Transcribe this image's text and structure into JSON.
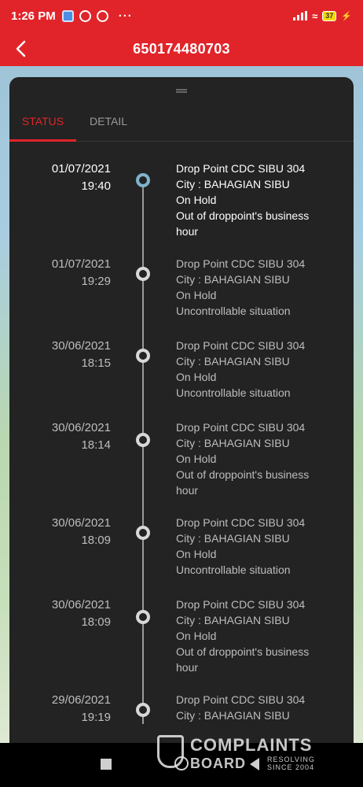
{
  "status_bar": {
    "time": "1:26 PM",
    "dots": "···",
    "battery": "37"
  },
  "app_bar": {
    "title": "650174480703",
    "back_icon": "chevron-left-icon"
  },
  "tabs": [
    {
      "label": "STATUS",
      "active": true
    },
    {
      "label": "DETAIL",
      "active": false
    }
  ],
  "events": [
    {
      "date": "01/07/2021",
      "time": "19:40",
      "location": "Drop Point CDC SIBU 304",
      "city": "City : BAHAGIAN SIBU",
      "status": "On Hold",
      "reason": "Out of droppoint's business hour"
    },
    {
      "date": "01/07/2021",
      "time": "19:29",
      "location": "Drop Point CDC SIBU 304",
      "city": "City : BAHAGIAN SIBU",
      "status": "On Hold",
      "reason": "Uncontrollable situation"
    },
    {
      "date": "30/06/2021",
      "time": "18:15",
      "location": "Drop Point CDC SIBU 304",
      "city": "City : BAHAGIAN SIBU",
      "status": "On Hold",
      "reason": "Uncontrollable situation"
    },
    {
      "date": "30/06/2021",
      "time": "18:14",
      "location": "Drop Point CDC SIBU 304",
      "city": "City : BAHAGIAN SIBU",
      "status": "On Hold",
      "reason": "Out of droppoint's business hour"
    },
    {
      "date": "30/06/2021",
      "time": "18:09",
      "location": "Drop Point CDC SIBU 304",
      "city": "City : BAHAGIAN SIBU",
      "status": "On Hold",
      "reason": "Uncontrollable situation"
    },
    {
      "date": "30/06/2021",
      "time": "18:09",
      "location": "Drop Point CDC SIBU 304",
      "city": "City : BAHAGIAN SIBU",
      "status": "On Hold",
      "reason": "Out of droppoint's business hour"
    },
    {
      "date": "29/06/2021",
      "time": "19:19",
      "location": "Drop Point CDC SIBU 304",
      "city": "City : BAHAGIAN SIBU"
    }
  ],
  "watermark": {
    "line1": "COMPLAINTS",
    "line2": "BOARD",
    "line3": "RESOLVING SINCE 2004"
  }
}
